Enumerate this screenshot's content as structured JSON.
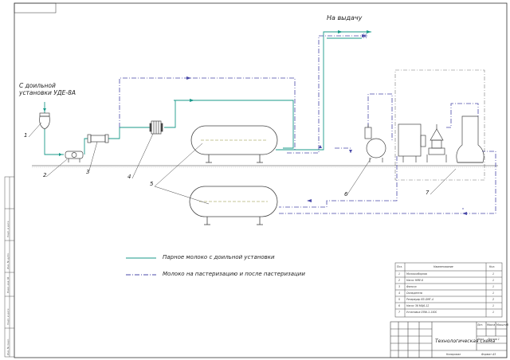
{
  "colors": {
    "milk_line": "#1a9a8a",
    "pasteur_line": "#4a4aa8",
    "ink": "#444444",
    "border": "#333333"
  },
  "labels": {
    "source_line1": "С доильной",
    "source_line2": "установки УДЕ-8А",
    "output": "На выдачу",
    "callout_1": "1",
    "callout_2": "2",
    "callout_3": "3",
    "callout_4": "4",
    "callout_5": "5",
    "callout_6": "6",
    "callout_7": "7"
  },
  "legend": {
    "raw_milk": "Парное молоко с доильной установки",
    "pasteurized": "Молоко на пастеризацию и после пастеризации"
  },
  "spec_table": {
    "headers": [
      "Поз.",
      "Наименование",
      "Кол."
    ],
    "rows": [
      [
        "1",
        "Молокосборник",
        "1"
      ],
      [
        "2",
        "Насос НМУ-6",
        "1"
      ],
      [
        "3",
        "Фильтр",
        "1"
      ],
      [
        "4",
        "Охладитель",
        "1"
      ],
      [
        "5",
        "Резервуар ВЗ-ОМГ-4",
        "2"
      ],
      [
        "6",
        "Насос 36 МЦ6-12",
        "1"
      ],
      [
        "7",
        "Установка ОПФ-1-1500",
        "1"
      ]
    ]
  },
  "title_block": {
    "title": "Технологическая схема",
    "mark_lit": "Лит.",
    "mark_mass": "Масса",
    "mark_scale": "Масштаб",
    "sheet": "Лист",
    "sheets": "Листов 1",
    "copied": "Копировал",
    "format": "Формат А3"
  },
  "side_stamp": {
    "cells": [
      "Инв. № подл.",
      "Подп. и дата",
      "Взам. инв. №",
      "Инв. № дубл.",
      "Подп. и дата"
    ]
  }
}
